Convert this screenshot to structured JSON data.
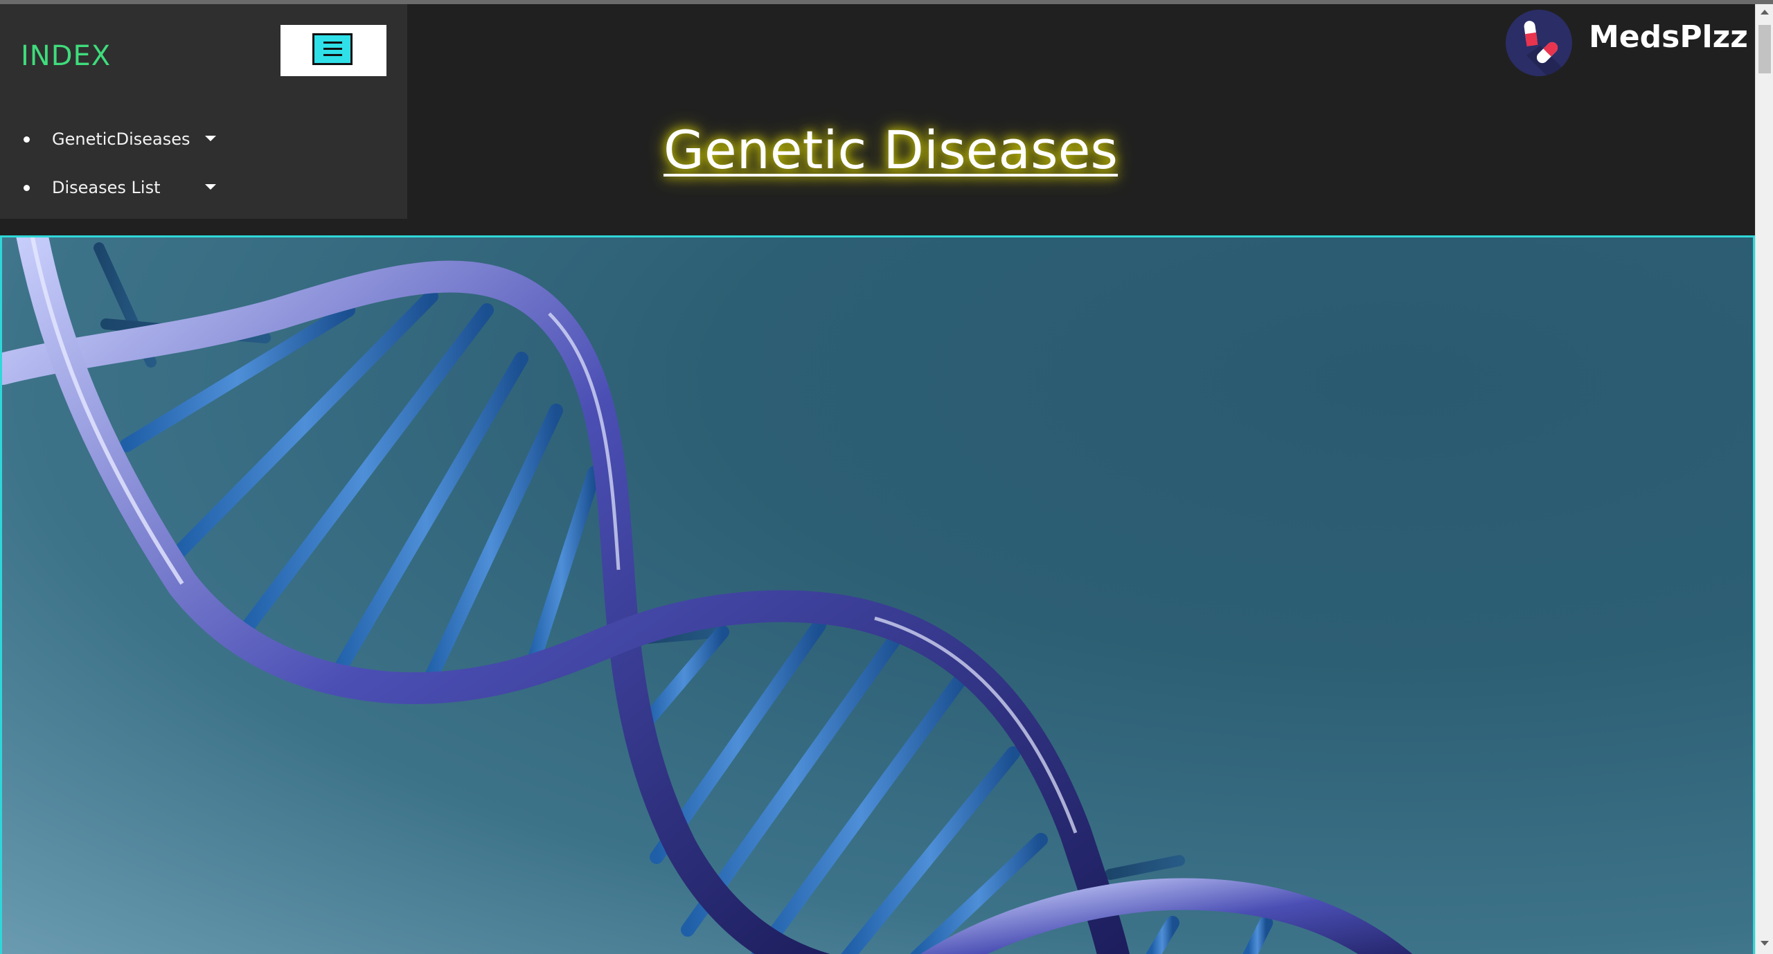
{
  "sidebar": {
    "title": "INDEX",
    "menu_toggle": "hamburger-menu",
    "items": [
      {
        "label": "GeneticDiseases",
        "icon": "caret-down-icon"
      },
      {
        "label": "Diseases List",
        "icon": "caret-down-icon"
      }
    ]
  },
  "header": {
    "title": "Genetic Diseases"
  },
  "brand": {
    "name": "MedsPlzz",
    "logo_icon": "pill-capsule-icon"
  },
  "hero": {
    "image": "dna-double-helix"
  },
  "colors": {
    "background": "#202020",
    "sidebar": "#2f2f2f",
    "index_title": "#3fdc7c",
    "accent_cyan": "#2fe0e8",
    "title_glow": "#e6e200",
    "logo_bg": "#2b2d66"
  }
}
